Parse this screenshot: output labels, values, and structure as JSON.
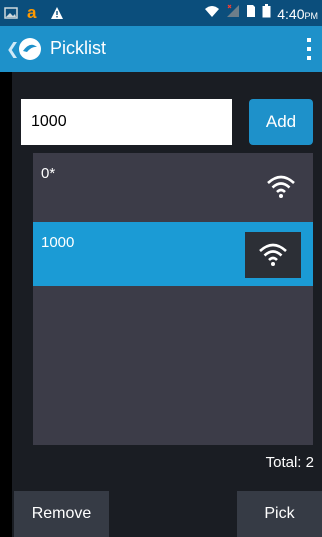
{
  "status_bar": {
    "time": "4:40",
    "ampm": "PM",
    "icons": [
      "gallery-icon",
      "amazon-icon",
      "warning-icon",
      "wifi-icon",
      "signal-icon",
      "sim-icon",
      "battery-icon"
    ]
  },
  "header": {
    "title": "Picklist"
  },
  "input": {
    "value": "1000",
    "add_label": "Add"
  },
  "list": {
    "items": [
      {
        "label": "0*",
        "selected": false,
        "icon": "wifi-icon"
      },
      {
        "label": "1000",
        "selected": true,
        "icon": "wifi-icon"
      }
    ]
  },
  "total_label": "Total: 2",
  "footer": {
    "remove_label": "Remove",
    "pick_label": "Pick"
  },
  "colors": {
    "status_bar": "#0b4e7c",
    "action_bar": "#1e91ca",
    "list_bg": "#3c3c48",
    "selected_row": "#1b9bd5",
    "button_bg": "#363b45"
  }
}
